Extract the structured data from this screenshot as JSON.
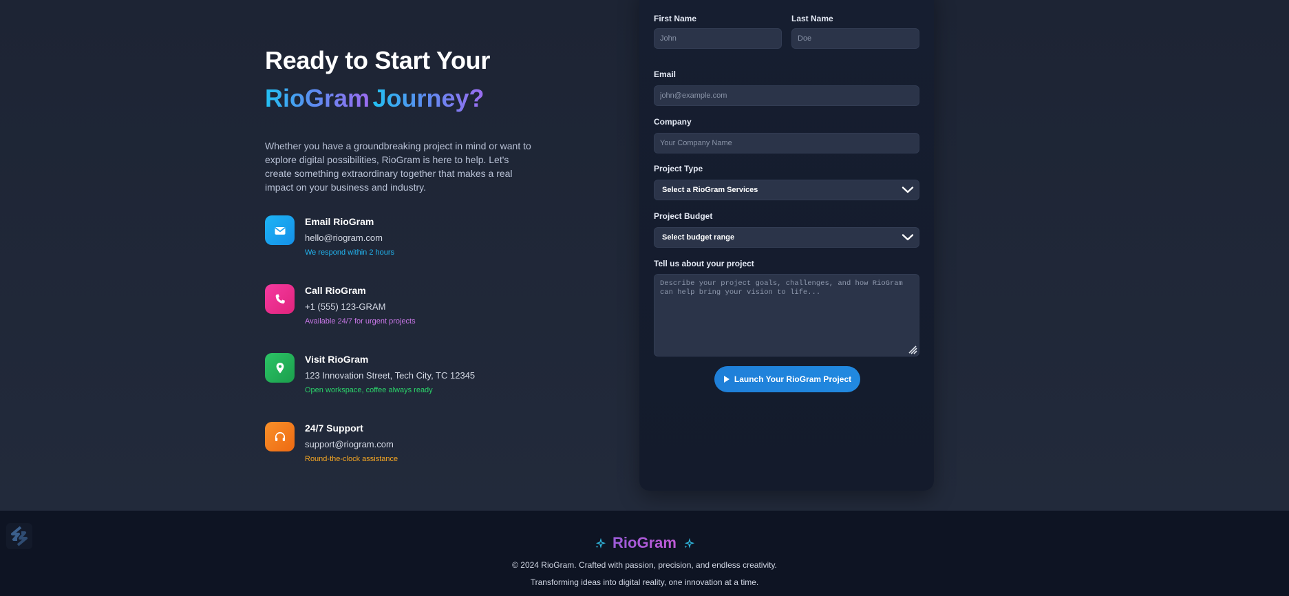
{
  "hero": {
    "headline_line1": "Ready to Start Your",
    "headline_line2_a": "RioGram",
    "headline_line2_b": "Journey?",
    "intro": "Whether you have a groundbreaking project in mind or want to explore digital possibilities, RioGram is here to help. Let's create something extraordinary together that makes a real impact on your business and industry."
  },
  "contacts": [
    {
      "icon": "envelope-icon",
      "title": "Email RioGram",
      "value": "hello@riogram.com",
      "note": "We respond within 2 hours",
      "color": "#1aa9f0",
      "note_color": "#22b6f2"
    },
    {
      "icon": "phone-icon",
      "title": "Call RioGram",
      "value": "+1 (555) 123-GRAM",
      "note": "Available 24/7 for urgent projects",
      "color": "#ec2c8e",
      "note_color": "#c978e8"
    },
    {
      "icon": "map-pin-icon",
      "title": "Visit RioGram",
      "value": "123 Innovation Street, Tech City, TC 12345",
      "note": "Open workspace, coffee always ready",
      "color": "#22b35a",
      "note_color": "#2bd46a"
    },
    {
      "icon": "headset-icon",
      "title": "24/7 Support",
      "value": "support@riogram.com",
      "note": "Round-the-clock assistance",
      "color": "#f37a1a",
      "note_color": "#f5a623"
    }
  ],
  "form": {
    "first_name_label": "First Name",
    "first_name_placeholder": "John",
    "last_name_label": "Last Name",
    "last_name_placeholder": "Doe",
    "email_label": "Email",
    "email_placeholder": "john@example.com",
    "company_label": "Company",
    "company_placeholder": "Your Company Name",
    "project_type_label": "Project Type",
    "project_type_value": "Select a RioGram Services",
    "budget_label": "Project Budget",
    "budget_value": "Select budget range",
    "message_label": "Tell us about your project",
    "message_placeholder": "Describe your project goals, challenges, and how RioGram can help bring your vision to life...",
    "submit_label": "Launch Your RioGram Project"
  },
  "footer": {
    "brand": "RioGram",
    "copyright": "© 2024 RioGram. Crafted with passion, precision, and endless creativity.",
    "tagline": "Transforming ideas into digital reality, one innovation at a time."
  }
}
